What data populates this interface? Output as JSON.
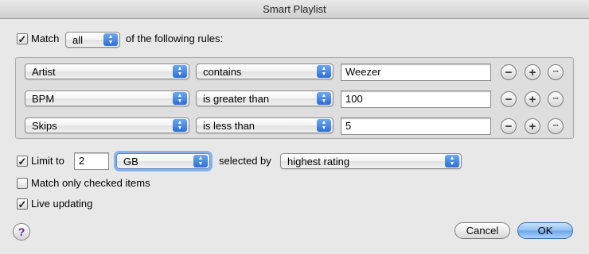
{
  "window": {
    "title": "Smart Playlist"
  },
  "match": {
    "checked": true,
    "checkmark": "✓",
    "label": "Match",
    "mode": "all",
    "suffix": "of the following rules:"
  },
  "rules": [
    {
      "field": "Artist",
      "operator": "contains",
      "value": "Weezer"
    },
    {
      "field": "BPM",
      "operator": "is greater than",
      "value": "100"
    },
    {
      "field": "Skips",
      "operator": "is less than",
      "value": "5"
    }
  ],
  "rule_buttons": {
    "remove": "−",
    "add": "+",
    "more": "···"
  },
  "limit": {
    "checked": true,
    "label": "Limit to",
    "amount": "2",
    "unit": "GB",
    "selected_by_label": "selected by",
    "selected_by": "highest rating"
  },
  "match_only_checked": {
    "checked": false,
    "label": "Match only checked items"
  },
  "live_updating": {
    "checked": true,
    "label": "Live updating"
  },
  "buttons": {
    "help": "?",
    "cancel": "Cancel",
    "ok": "OK"
  },
  "icons": {
    "popup_arrows": "up-down-arrows-icon",
    "checkmark": "checkmark-icon"
  },
  "colors": {
    "accent": "#2d6fd6",
    "default_button": "#8fbef2",
    "focus_ring": "#86b2e8"
  }
}
